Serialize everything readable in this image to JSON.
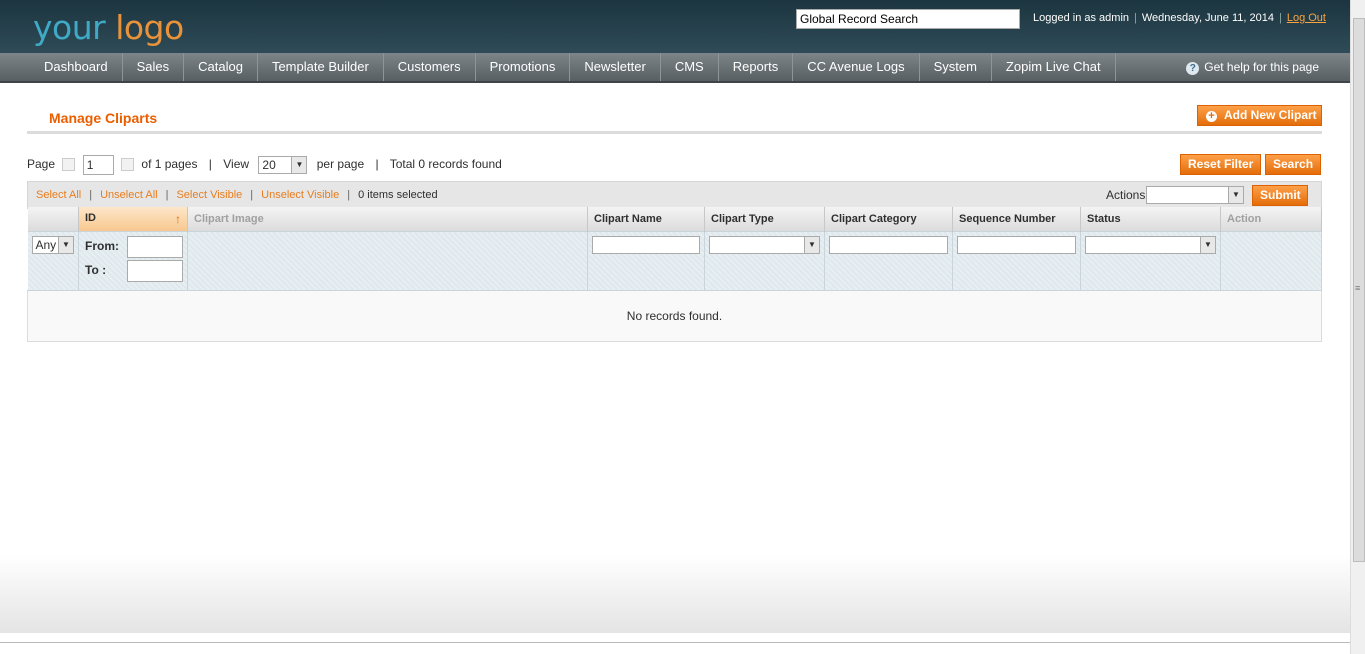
{
  "header": {
    "logo": {
      "part1": "your",
      "part2": "logo"
    },
    "search_value": "Global Record Search",
    "logged_in": "Logged in as admin",
    "date": "Wednesday, June 11, 2014",
    "logout": "Log Out"
  },
  "nav": {
    "items": [
      "Dashboard",
      "Sales",
      "Catalog",
      "Template Builder",
      "Customers",
      "Promotions",
      "Newsletter",
      "CMS",
      "Reports",
      "CC Avenue Logs",
      "System",
      "Zopim Live Chat"
    ],
    "help": "Get help for this page"
  },
  "page": {
    "title": "Manage Cliparts",
    "add_button": "Add New Clipart",
    "reset_button": "Reset Filter",
    "search_button": "Search"
  },
  "pager": {
    "page_label": "Page",
    "current_page": "1",
    "of_pages": "of 1 pages",
    "view_label": "View",
    "per_page_value": "20",
    "per_page_label": "per page",
    "total": "Total 0 records found"
  },
  "massaction": {
    "select_all": "Select All",
    "unselect_all": "Unselect All",
    "select_visible": "Select Visible",
    "unselect_visible": "Unselect Visible",
    "count": "0 items selected",
    "actions_label": "Actions",
    "submit": "Submit"
  },
  "grid": {
    "columns": [
      "ID",
      "Clipart Image",
      "Clipart Name",
      "Clipart Type",
      "Clipart Category",
      "Sequence Number",
      "Status",
      "Action"
    ],
    "filter": {
      "any": "Any",
      "from": "From:",
      "to": "To :"
    },
    "empty": "No records found."
  }
}
